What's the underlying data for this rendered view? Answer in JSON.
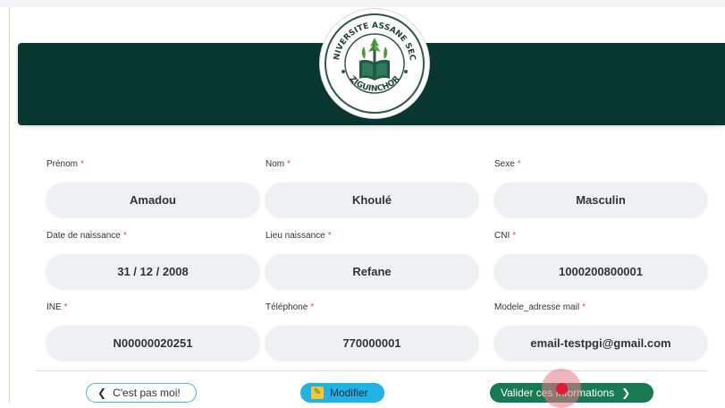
{
  "logo": {
    "arc_top": "UNIVERSITE ASSANE SECK",
    "arc_bottom": "ZIGUINCHOR"
  },
  "form": {
    "required_marker": "*",
    "fields": [
      {
        "label": "Prénom",
        "value": "Amadou"
      },
      {
        "label": "Nom",
        "value": "Khoulé"
      },
      {
        "label": "Sexe",
        "value": "Masculin"
      },
      {
        "label": "Date de naissance",
        "value": "31 / 12 / 2008"
      },
      {
        "label": "Lieu naissance",
        "value": "Refane"
      },
      {
        "label": "CNI",
        "value": "1000200800001"
      },
      {
        "label": "INE",
        "value": "N00000020251"
      },
      {
        "label": "Téléphone",
        "value": "770000001"
      },
      {
        "label": "Modele_adresse mail",
        "value": "email-testpgi@gmail.com"
      }
    ]
  },
  "actions": {
    "back_label": "C'est pas moi!",
    "edit_label": "Modifier",
    "validate_label": "Valider ces informations"
  },
  "colors": {
    "banner": "#08372f",
    "validate": "#177a52",
    "edit": "#1fb3e8",
    "required": "#e2524f"
  },
  "icons": {
    "back": "chevron-left-icon",
    "edit": "pencil-icon",
    "validate": "chevron-right-icon"
  }
}
